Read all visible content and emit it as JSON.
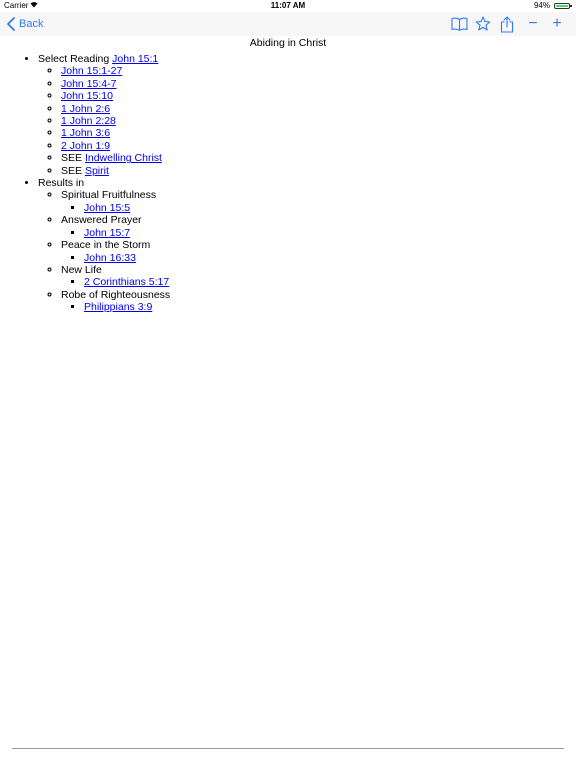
{
  "status_bar": {
    "carrier": "Carrier",
    "time": "11:07 AM",
    "battery_pct": "94%",
    "battery_level": 0.94
  },
  "nav": {
    "back_label": "Back",
    "zoom_out": "−",
    "zoom_in": "+"
  },
  "colors": {
    "accent": "#2f7bf5",
    "link": "#0000ee",
    "nav_background": "#f7f7f7"
  },
  "page": {
    "title": "Abiding in Christ"
  },
  "outline": {
    "select_reading": {
      "label": "Select Reading",
      "link": "John 15:1",
      "items": [
        {
          "link": "John 15:1-27"
        },
        {
          "link": "John 15:4-7"
        },
        {
          "link": "John 15:10"
        },
        {
          "link": "1 John 2:6"
        },
        {
          "link": "1 John 2:28"
        },
        {
          "link": "1 John 3:6"
        },
        {
          "link": "2 John 1:9"
        },
        {
          "prefix": "SEE",
          "link": "Indwelling Christ"
        },
        {
          "prefix": "SEE",
          "link": "Spirit"
        }
      ]
    },
    "results_in": {
      "label": "Results in",
      "items": [
        {
          "label": "Spiritual Fruitfulness",
          "link": "John 15:5"
        },
        {
          "label": "Answered Prayer",
          "link": "John 15:7"
        },
        {
          "label": "Peace in the Storm",
          "link": "John 16:33"
        },
        {
          "label": "New Life",
          "link": "2 Corinthians 5:17"
        },
        {
          "label": "Robe of Righteousness",
          "link": "Philippians 3:9"
        }
      ]
    }
  }
}
